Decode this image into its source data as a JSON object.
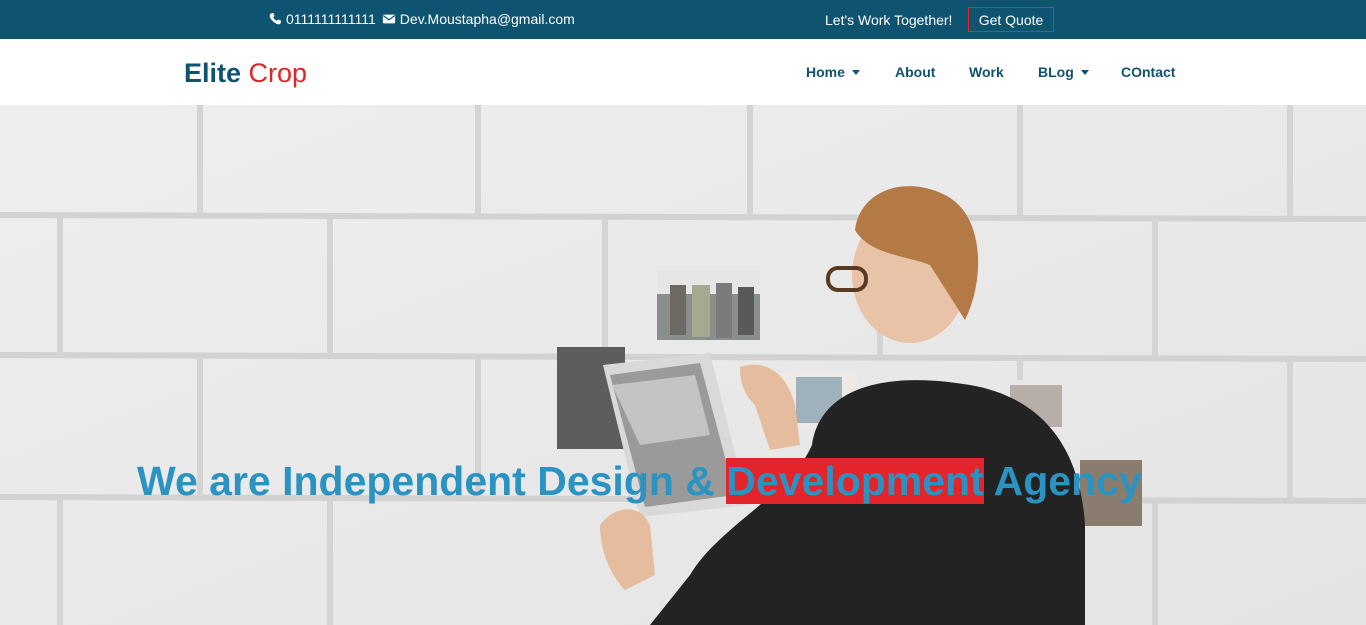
{
  "topbar": {
    "phone": "0111111111111",
    "email": "Dev.Moustapha@gmail.com",
    "cta_text": "Let's Work Together!",
    "quote_label": "Get Quote",
    "phone_icon": "phone-icon",
    "email_icon": "envelope-icon"
  },
  "brand": {
    "part1": "Elite",
    "part2": "Crop"
  },
  "nav": {
    "items": [
      {
        "label": "Home",
        "dropdown": true
      },
      {
        "label": "About",
        "dropdown": false
      },
      {
        "label": "Work",
        "dropdown": false
      },
      {
        "label": "BLog",
        "dropdown": true
      },
      {
        "label": "COntact",
        "dropdown": false
      }
    ]
  },
  "hero": {
    "headline_before": "We are Independent Design & ",
    "headline_highlight": "Development",
    "headline_after": " Agency"
  },
  "colors": {
    "primary": "#0e5470",
    "accent": "#e3242b",
    "headline": "#2a93c1"
  }
}
